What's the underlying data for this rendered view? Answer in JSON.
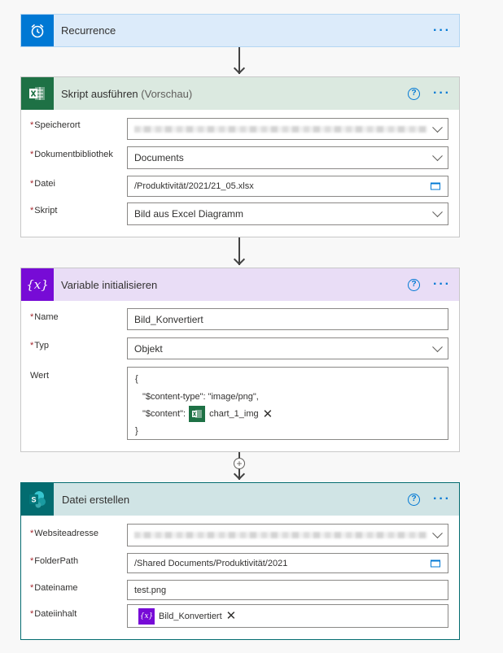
{
  "steps": {
    "recurrence": {
      "title": "Recurrence",
      "icon": "alarm-clock-icon",
      "color": "#0078d4"
    },
    "run_script": {
      "title": "Skript ausführen",
      "title_suffix": "(Vorschau)",
      "icon": "excel-icon",
      "color": "#1e7145",
      "fields": {
        "location": {
          "label": "Speicherort",
          "value": ""
        },
        "library": {
          "label": "Dokumentbibliothek",
          "value": "Documents"
        },
        "file": {
          "label": "Datei",
          "value": "/Produktivität/2021/21_05.xlsx"
        },
        "script": {
          "label": "Skript",
          "value": "Bild aus Excel Diagramm"
        }
      }
    },
    "init_variable": {
      "title": "Variable initialisieren",
      "icon": "variable-icon",
      "color": "#770bd6",
      "fields": {
        "name": {
          "label": "Name",
          "value": "Bild_Konvertiert"
        },
        "type": {
          "label": "Typ",
          "value": "Objekt"
        },
        "value": {
          "label": "Wert",
          "line_open": "{",
          "line_type": "\"$content-type\": \"image/png\",",
          "line_content_key": "\"$content\":",
          "token": "chart_1_img",
          "line_close": "}"
        }
      }
    },
    "create_file": {
      "title": "Datei erstellen",
      "icon": "sharepoint-icon",
      "color": "#036c70",
      "fields": {
        "site": {
          "label": "Websiteadresse",
          "value": ""
        },
        "folder": {
          "label": "FolderPath",
          "value": "/Shared Documents/Produktivität/2021"
        },
        "filename": {
          "label": "Dateiname",
          "value": "test.png"
        },
        "content": {
          "label": "Dateiinhalt",
          "token": "Bild_Konvertiert"
        }
      }
    }
  },
  "ui": {
    "more": "···",
    "help": "?",
    "required": "*",
    "remove": "✕",
    "add": "+"
  }
}
